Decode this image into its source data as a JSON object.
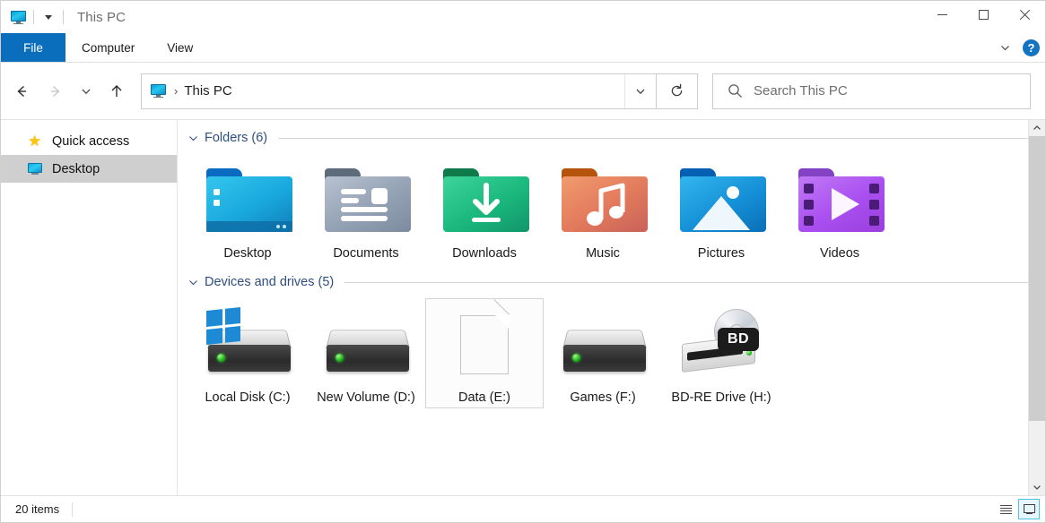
{
  "window": {
    "title": "This PC",
    "qat_icon": "monitor-icon",
    "qat_dropdown_icon": "chevron-down-icon",
    "caption": {
      "minimize": "minimize-icon",
      "maximize": "maximize-icon",
      "close": "close-icon"
    }
  },
  "ribbon": {
    "tabs": [
      {
        "label": "File",
        "active": true
      },
      {
        "label": "Computer",
        "active": false
      },
      {
        "label": "View",
        "active": false
      }
    ],
    "collapse_icon": "chevron-down-icon",
    "help_label": "?"
  },
  "nav": {
    "back_icon": "arrow-left-icon",
    "forward_icon": "arrow-right-icon",
    "recent_icon": "chevron-down-icon",
    "up_icon": "arrow-up-icon",
    "address": {
      "icon": "monitor-icon",
      "separator": "›",
      "crumb": "This PC",
      "dropdown_icon": "chevron-down-icon"
    },
    "refresh_icon": "refresh-icon",
    "search": {
      "icon": "search-icon",
      "placeholder": "Search This PC",
      "value": ""
    }
  },
  "sidebar": {
    "items": [
      {
        "label": "Quick access",
        "icon": "star-icon",
        "selected": false
      },
      {
        "label": "Desktop",
        "icon": "monitor-icon",
        "selected": true
      }
    ]
  },
  "main": {
    "groups": [
      {
        "title": "Folders (6)",
        "chevron": "chevron-down-icon",
        "items": [
          {
            "label": "Desktop",
            "icon": "folder-desktop-icon"
          },
          {
            "label": "Documents",
            "icon": "folder-documents-icon"
          },
          {
            "label": "Downloads",
            "icon": "folder-downloads-icon"
          },
          {
            "label": "Music",
            "icon": "folder-music-icon"
          },
          {
            "label": "Pictures",
            "icon": "folder-pictures-icon"
          },
          {
            "label": "Videos",
            "icon": "folder-videos-icon"
          }
        ]
      },
      {
        "title": "Devices and drives (5)",
        "chevron": "chevron-down-icon",
        "items": [
          {
            "label": "Local Disk (C:)",
            "icon": "hard-drive-windows-icon",
            "hovered": false
          },
          {
            "label": "New Volume (D:)",
            "icon": "hard-drive-icon",
            "hovered": false
          },
          {
            "label": "Data (E:)",
            "icon": "blank-page-icon",
            "hovered": true
          },
          {
            "label": "Games (F:)",
            "icon": "hard-drive-icon",
            "hovered": false
          },
          {
            "label": "BD-RE Drive (H:)",
            "icon": "optical-drive-bd-icon",
            "hovered": false
          }
        ]
      }
    ]
  },
  "scrollbar": {
    "up_icon": "chevron-up-icon",
    "down_icon": "chevron-down-icon"
  },
  "status": {
    "item_count": "20 items",
    "views": [
      {
        "name": "details-view",
        "icon": "list-lines-icon",
        "active": false
      },
      {
        "name": "large-icons-view",
        "icon": "large-icon-icon",
        "active": true
      }
    ]
  },
  "colors": {
    "accent": "#0b6ebd",
    "group_header": "#2e4e82",
    "selection": "#cfcfcf",
    "view_active_border": "#4cc2e8"
  }
}
